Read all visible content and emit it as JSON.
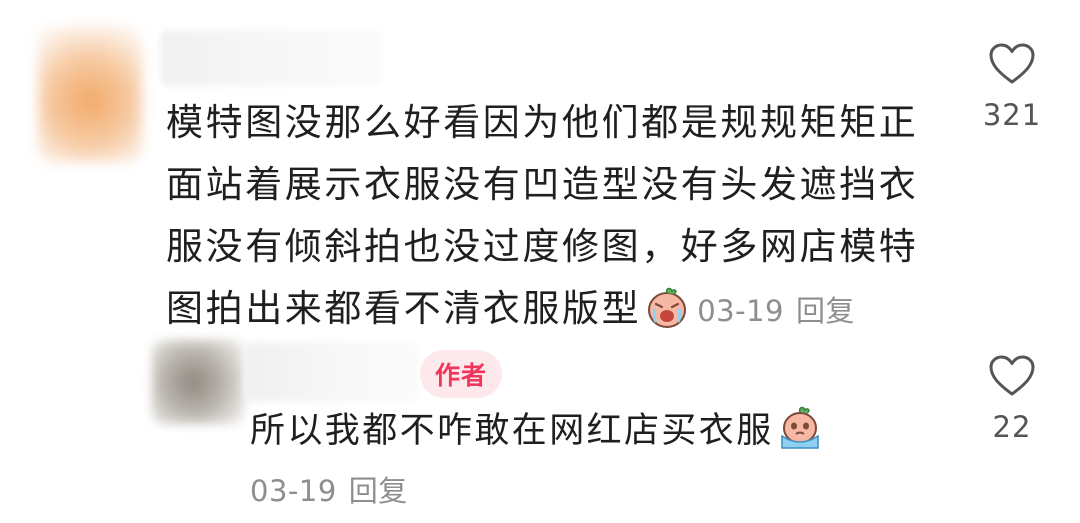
{
  "comment": {
    "text": "模特图没那么好看因为他们都是规规矩矩正面站着展示衣服没有凹造型没有头发遮挡衣服没有倾斜拍也没过度修图，好多网店模特图拍出来都看不清衣服版型",
    "emoji_icon": "crying-face-emoji",
    "date": "03-19",
    "reply_label": "回复",
    "like_count": "321",
    "like_icon": "heart-outline-icon"
  },
  "reply": {
    "badge": "作者",
    "text": "所以我都不咋敢在网红店买衣服",
    "emoji_icon": "crying-sweating-face-emoji",
    "date": "03-19",
    "reply_label": "回复",
    "like_count": "22",
    "like_icon": "heart-outline-icon"
  },
  "colors": {
    "badge_text": "#f0365b",
    "badge_bg": "#fde8ec",
    "meta_text": "#8e8e8e"
  }
}
